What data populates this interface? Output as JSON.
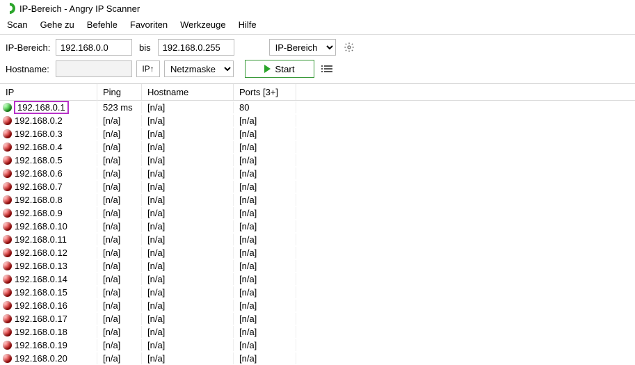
{
  "window": {
    "title": "IP-Bereich - Angry IP Scanner"
  },
  "menu": {
    "scan": "Scan",
    "goto": "Gehe zu",
    "commands": "Befehle",
    "favorites": "Favoriten",
    "tools": "Werkzeuge",
    "help": "Hilfe"
  },
  "toolbar": {
    "range_label": "IP-Bereich:",
    "ip_start": "192.168.0.0",
    "bis": "bis",
    "ip_end": "192.168.0.255",
    "range_type": "IP-Bereich",
    "hostname_label": "Hostname:",
    "hostname_value": "",
    "ip_up": "IP↑",
    "mask": "Netzmaske",
    "start": "Start"
  },
  "columns": {
    "ip": "IP",
    "ping": "Ping",
    "hostname": "Hostname",
    "ports": "Ports [3+]"
  },
  "rows": [
    {
      "status": "green",
      "ip": "192.168.0.1",
      "ping": "523 ms",
      "hostname": "[n/a]",
      "ports": "80",
      "selected": true
    },
    {
      "status": "red",
      "ip": "192.168.0.2",
      "ping": "[n/a]",
      "hostname": "[n/a]",
      "ports": "[n/a]"
    },
    {
      "status": "red",
      "ip": "192.168.0.3",
      "ping": "[n/a]",
      "hostname": "[n/a]",
      "ports": "[n/a]"
    },
    {
      "status": "red",
      "ip": "192.168.0.4",
      "ping": "[n/a]",
      "hostname": "[n/a]",
      "ports": "[n/a]"
    },
    {
      "status": "red",
      "ip": "192.168.0.5",
      "ping": "[n/a]",
      "hostname": "[n/a]",
      "ports": "[n/a]"
    },
    {
      "status": "red",
      "ip": "192.168.0.6",
      "ping": "[n/a]",
      "hostname": "[n/a]",
      "ports": "[n/a]"
    },
    {
      "status": "red",
      "ip": "192.168.0.7",
      "ping": "[n/a]",
      "hostname": "[n/a]",
      "ports": "[n/a]"
    },
    {
      "status": "red",
      "ip": "192.168.0.8",
      "ping": "[n/a]",
      "hostname": "[n/a]",
      "ports": "[n/a]"
    },
    {
      "status": "red",
      "ip": "192.168.0.9",
      "ping": "[n/a]",
      "hostname": "[n/a]",
      "ports": "[n/a]"
    },
    {
      "status": "red",
      "ip": "192.168.0.10",
      "ping": "[n/a]",
      "hostname": "[n/a]",
      "ports": "[n/a]"
    },
    {
      "status": "red",
      "ip": "192.168.0.11",
      "ping": "[n/a]",
      "hostname": "[n/a]",
      "ports": "[n/a]"
    },
    {
      "status": "red",
      "ip": "192.168.0.12",
      "ping": "[n/a]",
      "hostname": "[n/a]",
      "ports": "[n/a]"
    },
    {
      "status": "red",
      "ip": "192.168.0.13",
      "ping": "[n/a]",
      "hostname": "[n/a]",
      "ports": "[n/a]"
    },
    {
      "status": "red",
      "ip": "192.168.0.14",
      "ping": "[n/a]",
      "hostname": "[n/a]",
      "ports": "[n/a]"
    },
    {
      "status": "red",
      "ip": "192.168.0.15",
      "ping": "[n/a]",
      "hostname": "[n/a]",
      "ports": "[n/a]"
    },
    {
      "status": "red",
      "ip": "192.168.0.16",
      "ping": "[n/a]",
      "hostname": "[n/a]",
      "ports": "[n/a]"
    },
    {
      "status": "red",
      "ip": "192.168.0.17",
      "ping": "[n/a]",
      "hostname": "[n/a]",
      "ports": "[n/a]"
    },
    {
      "status": "red",
      "ip": "192.168.0.18",
      "ping": "[n/a]",
      "hostname": "[n/a]",
      "ports": "[n/a]"
    },
    {
      "status": "red",
      "ip": "192.168.0.19",
      "ping": "[n/a]",
      "hostname": "[n/a]",
      "ports": "[n/a]"
    },
    {
      "status": "red",
      "ip": "192.168.0.20",
      "ping": "[n/a]",
      "hostname": "[n/a]",
      "ports": "[n/a]"
    }
  ]
}
